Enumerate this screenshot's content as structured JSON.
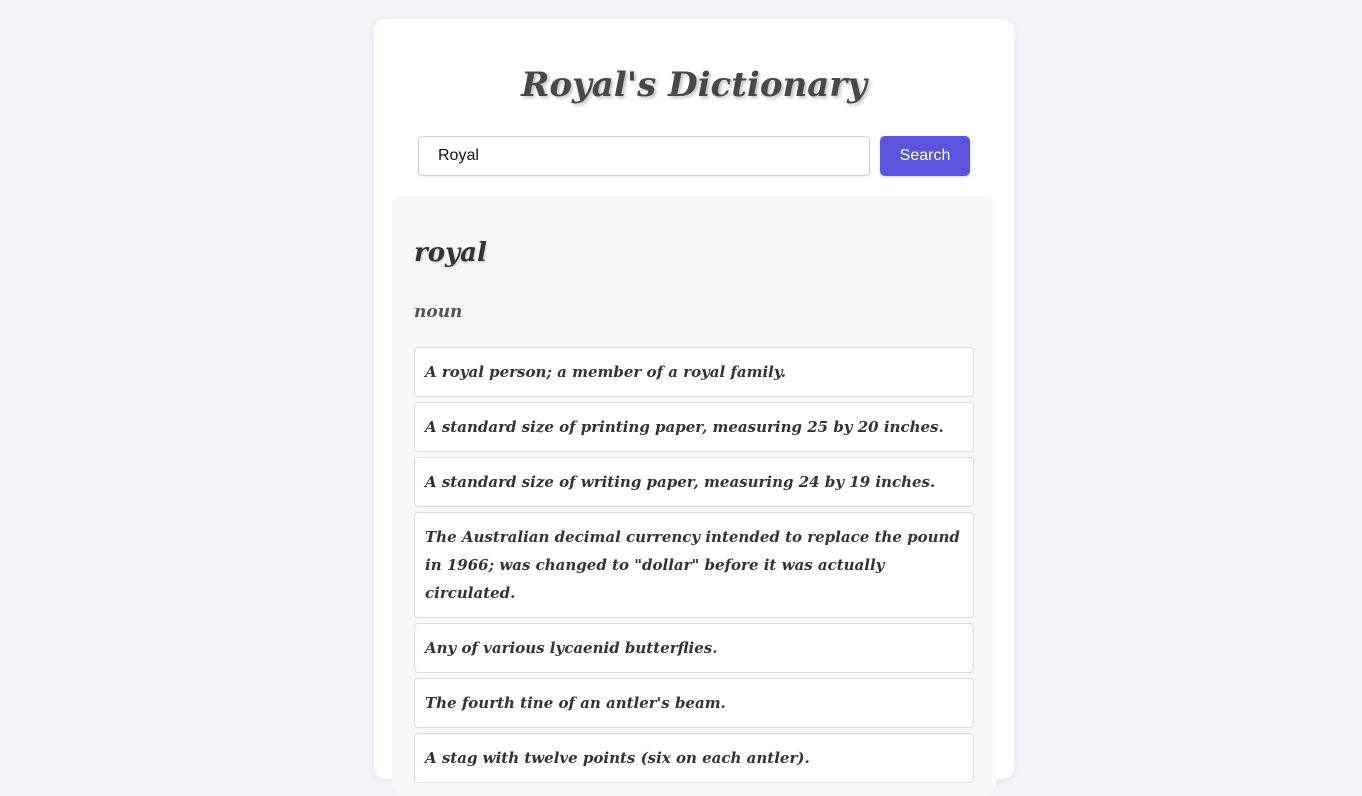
{
  "app": {
    "title": "Royal's Dictionary"
  },
  "search": {
    "value": "Royal",
    "placeholder": "",
    "button_label": "Search"
  },
  "result": {
    "word": "royal",
    "part_of_speech": "noun",
    "definitions": [
      "A royal person; a member of a royal family.",
      "A standard size of printing paper, measuring 25 by 20 inches.",
      "A standard size of writing paper, measuring 24 by 19 inches.",
      "The Australian decimal currency intended to replace the pound in 1966; was changed to \"dollar\" before it was actually circulated.",
      "Any of various lycaenid butterflies.",
      "The fourth tine of an antler's beam.",
      "A stag with twelve points (six on each antler)."
    ]
  },
  "colors": {
    "accent": "#5b54dc",
    "background": "#f4f3f8",
    "card": "#ffffff",
    "panel": "#f8f8f8"
  }
}
